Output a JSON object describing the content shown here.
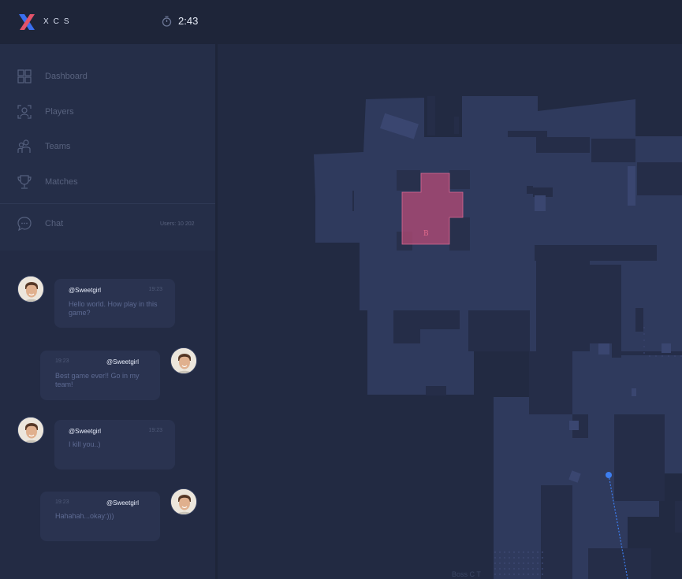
{
  "brand": {
    "name": "XCS"
  },
  "timer": {
    "value": "2:43"
  },
  "nav": {
    "items": [
      {
        "label": "Dashboard"
      },
      {
        "label": "Players"
      },
      {
        "label": "Teams"
      },
      {
        "label": "Matches"
      }
    ],
    "chat": {
      "label": "Chat",
      "users": "Users: 10 202"
    }
  },
  "chat": {
    "messages": [
      {
        "user": "@Sweetgirl",
        "time": "19:23",
        "text": "Hello world. How play in this game?",
        "side": "left"
      },
      {
        "user": "@Sweetgirl",
        "time": "19:23",
        "text": "Best game ever!! Go in my team!",
        "side": "right"
      },
      {
        "user": "@Sweetgirl",
        "time": "19:23",
        "text": "I kill you..)",
        "side": "left"
      },
      {
        "user": "@Sweetgirl",
        "time": "19:23",
        "text": "Hahahah...okay:)))",
        "side": "right"
      }
    ]
  },
  "map": {
    "site_label": "B",
    "bottom_label": "Boss C T",
    "colors": {
      "background": "#222a42",
      "floor": "#2f3a5d",
      "site": "#b14a74",
      "player": "#3d7ef0"
    }
  }
}
